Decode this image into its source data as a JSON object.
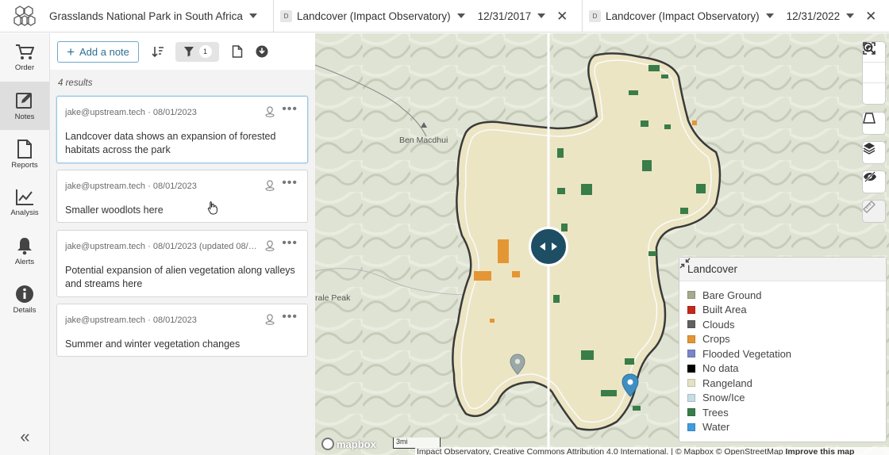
{
  "topbar": {
    "project": "Grasslands National Park in South Africa",
    "left_layer": {
      "badge": "D",
      "name": "Landcover (Impact Observatory)",
      "date": "12/31/2017"
    },
    "right_layer": {
      "badge": "D",
      "name": "Landcover (Impact Observatory)",
      "date": "12/31/2022"
    },
    "close": "✕"
  },
  "nav": [
    {
      "id": "order",
      "label": "Order",
      "icon": "cart-icon"
    },
    {
      "id": "notes",
      "label": "Notes",
      "icon": "note-edit-icon",
      "active": true
    },
    {
      "id": "reports",
      "label": "Reports",
      "icon": "document-icon"
    },
    {
      "id": "analysis",
      "label": "Analysis",
      "icon": "line-chart-icon"
    },
    {
      "id": "alerts",
      "label": "Alerts",
      "icon": "bell-icon"
    },
    {
      "id": "details",
      "label": "Details",
      "icon": "info-icon"
    }
  ],
  "collapse_label": "«",
  "notes_toolbar": {
    "add_label": "Add a note",
    "filter_count": "1"
  },
  "results_label": "4 results",
  "notes": [
    {
      "meta": "jake@upstream.tech · 08/01/2023",
      "text": "Landcover data shows an expansion of forested habitats across the park"
    },
    {
      "meta": "jake@upstream.tech · 08/01/2023",
      "text": "Smaller woodlots here"
    },
    {
      "meta": "jake@upstream.tech · 08/01/2023 (updated 08/01...",
      "text": "Potential expansion of alien vegetation along valleys and streams here"
    },
    {
      "meta": "jake@upstream.tech · 08/01/2023",
      "text": "Summer and winter vegetation changes"
    }
  ],
  "more_label": "•••",
  "map": {
    "places": {
      "ben_macdhui": "Ben Macdhui",
      "peak": "rale Peak"
    },
    "mapbox": "mapbox",
    "scale": "3mi",
    "attribution": "Impact Observatory, Creative Commons Attribution 4.0 International. | © Mapbox © OpenStreetMap",
    "improve": "Improve this map"
  },
  "legend": {
    "title": "Landcover",
    "items": [
      {
        "label": "Bare Ground",
        "color": "#a5ab8c"
      },
      {
        "label": "Built Area",
        "color": "#c4281b"
      },
      {
        "label": "Clouds",
        "color": "#616161"
      },
      {
        "label": "Crops",
        "color": "#e49635"
      },
      {
        "label": "Flooded Vegetation",
        "color": "#7a87c6"
      },
      {
        "label": "No data",
        "color": "#000000"
      },
      {
        "label": "Rangeland",
        "color": "#e3e2c3"
      },
      {
        "label": "Snow/Ice",
        "color": "#c5dde6"
      },
      {
        "label": "Trees",
        "color": "#397d49"
      },
      {
        "label": "Water",
        "color": "#419bdf"
      }
    ]
  }
}
